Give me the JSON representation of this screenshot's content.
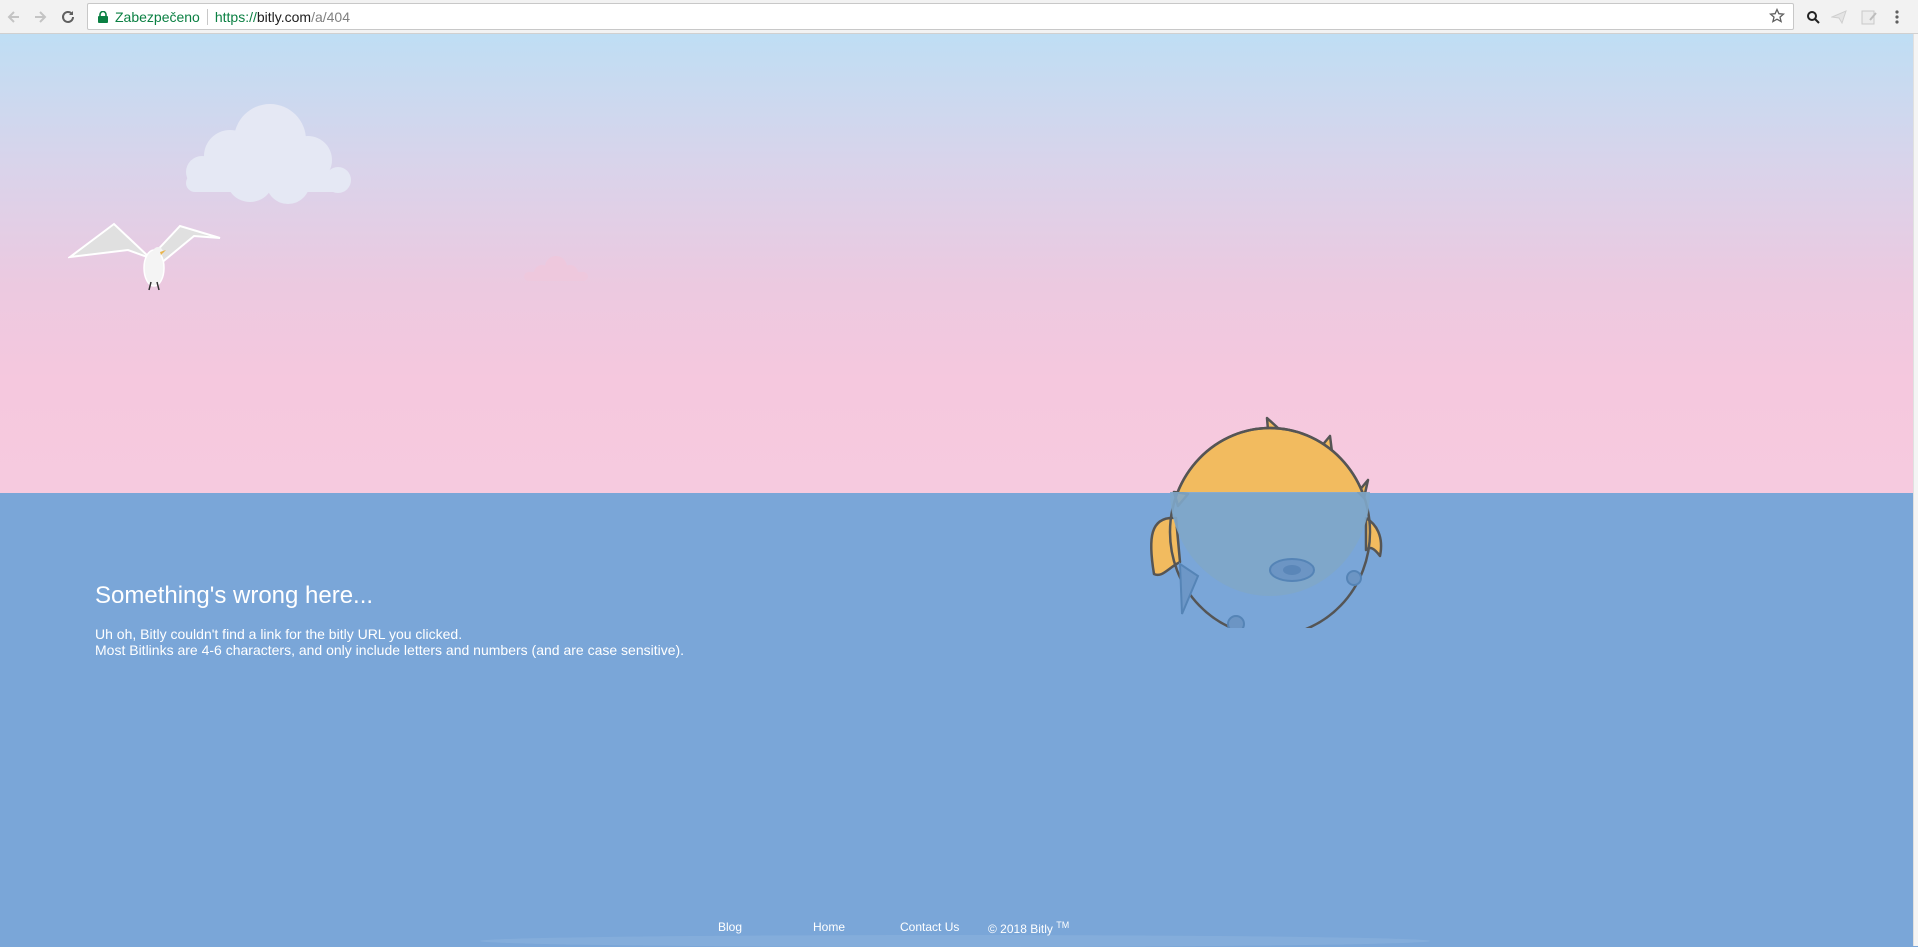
{
  "browser": {
    "security_label": "Zabezpečeno",
    "url_scheme": "https://",
    "url_host": "bitly.com",
    "url_path": "/a/404",
    "icons": [
      "back-icon",
      "forward-icon",
      "reload-icon",
      "lock-icon",
      "bookmark-star-icon",
      "search-extension-icon",
      "send-extension-icon",
      "note-extension-icon",
      "menu-icon"
    ]
  },
  "content": {
    "headline": "Something's wrong here...",
    "line1": "Uh oh, Bitly couldn't find a link for the bitly URL you clicked.",
    "line2": "Most Bitlinks are 4-6 characters, and only include letters and numbers (and are case sensitive)."
  },
  "footer": {
    "blog": "Blog",
    "home": "Home",
    "contact": "Contact Us",
    "copyright": "© 2018 Bitly",
    "tm": "TM"
  },
  "colors": {
    "sea": "#7aa6d8",
    "sky_top": "#bfdef4",
    "sky_bottom": "#f6cadf",
    "pufferfish": "#f2bb5f",
    "secure_green": "#0b8043"
  }
}
